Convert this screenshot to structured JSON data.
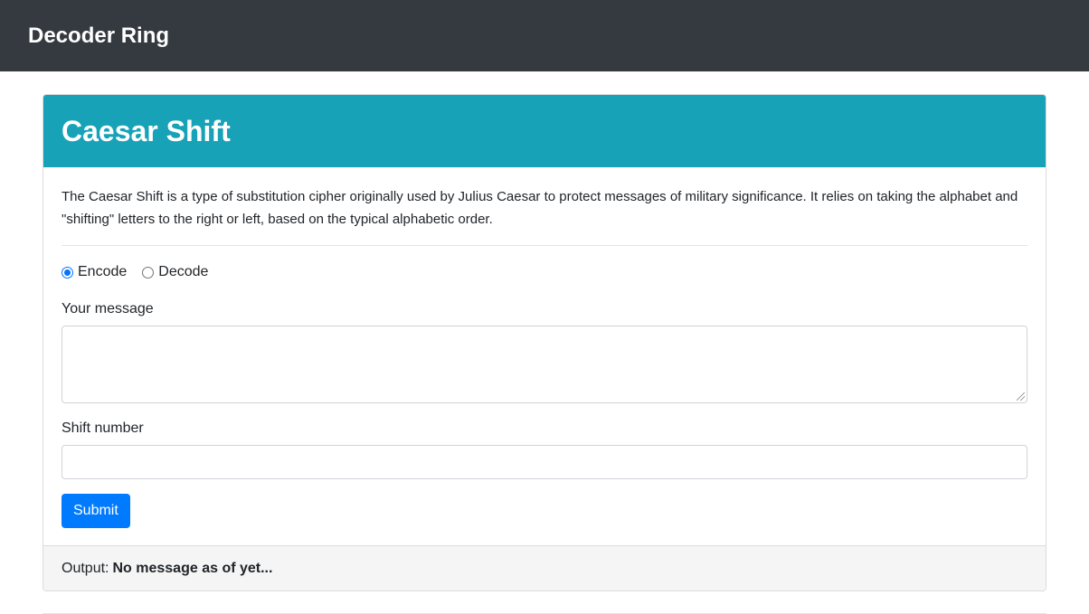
{
  "navbar": {
    "brand": "Decoder Ring"
  },
  "card": {
    "title": "Caesar Shift",
    "description": "The Caesar Shift is a type of substitution cipher originally used by Julius Caesar to protect messages of military significance. It relies on taking the alphabet and \"shifting\" letters to the right or left, based on the typical alphabetic order.",
    "mode": {
      "options": [
        "Encode",
        "Decode"
      ],
      "selected": "Encode"
    },
    "message": {
      "label": "Your message",
      "value": ""
    },
    "shift": {
      "label": "Shift number",
      "value": ""
    },
    "submit_label": "Submit",
    "output": {
      "label": "Output:",
      "value": "No message as of yet..."
    }
  },
  "colors": {
    "navbar_bg": "#343a40",
    "header_bg": "#17a2b8",
    "button_bg": "#007bff",
    "footer_bg": "#f5f5f5"
  }
}
